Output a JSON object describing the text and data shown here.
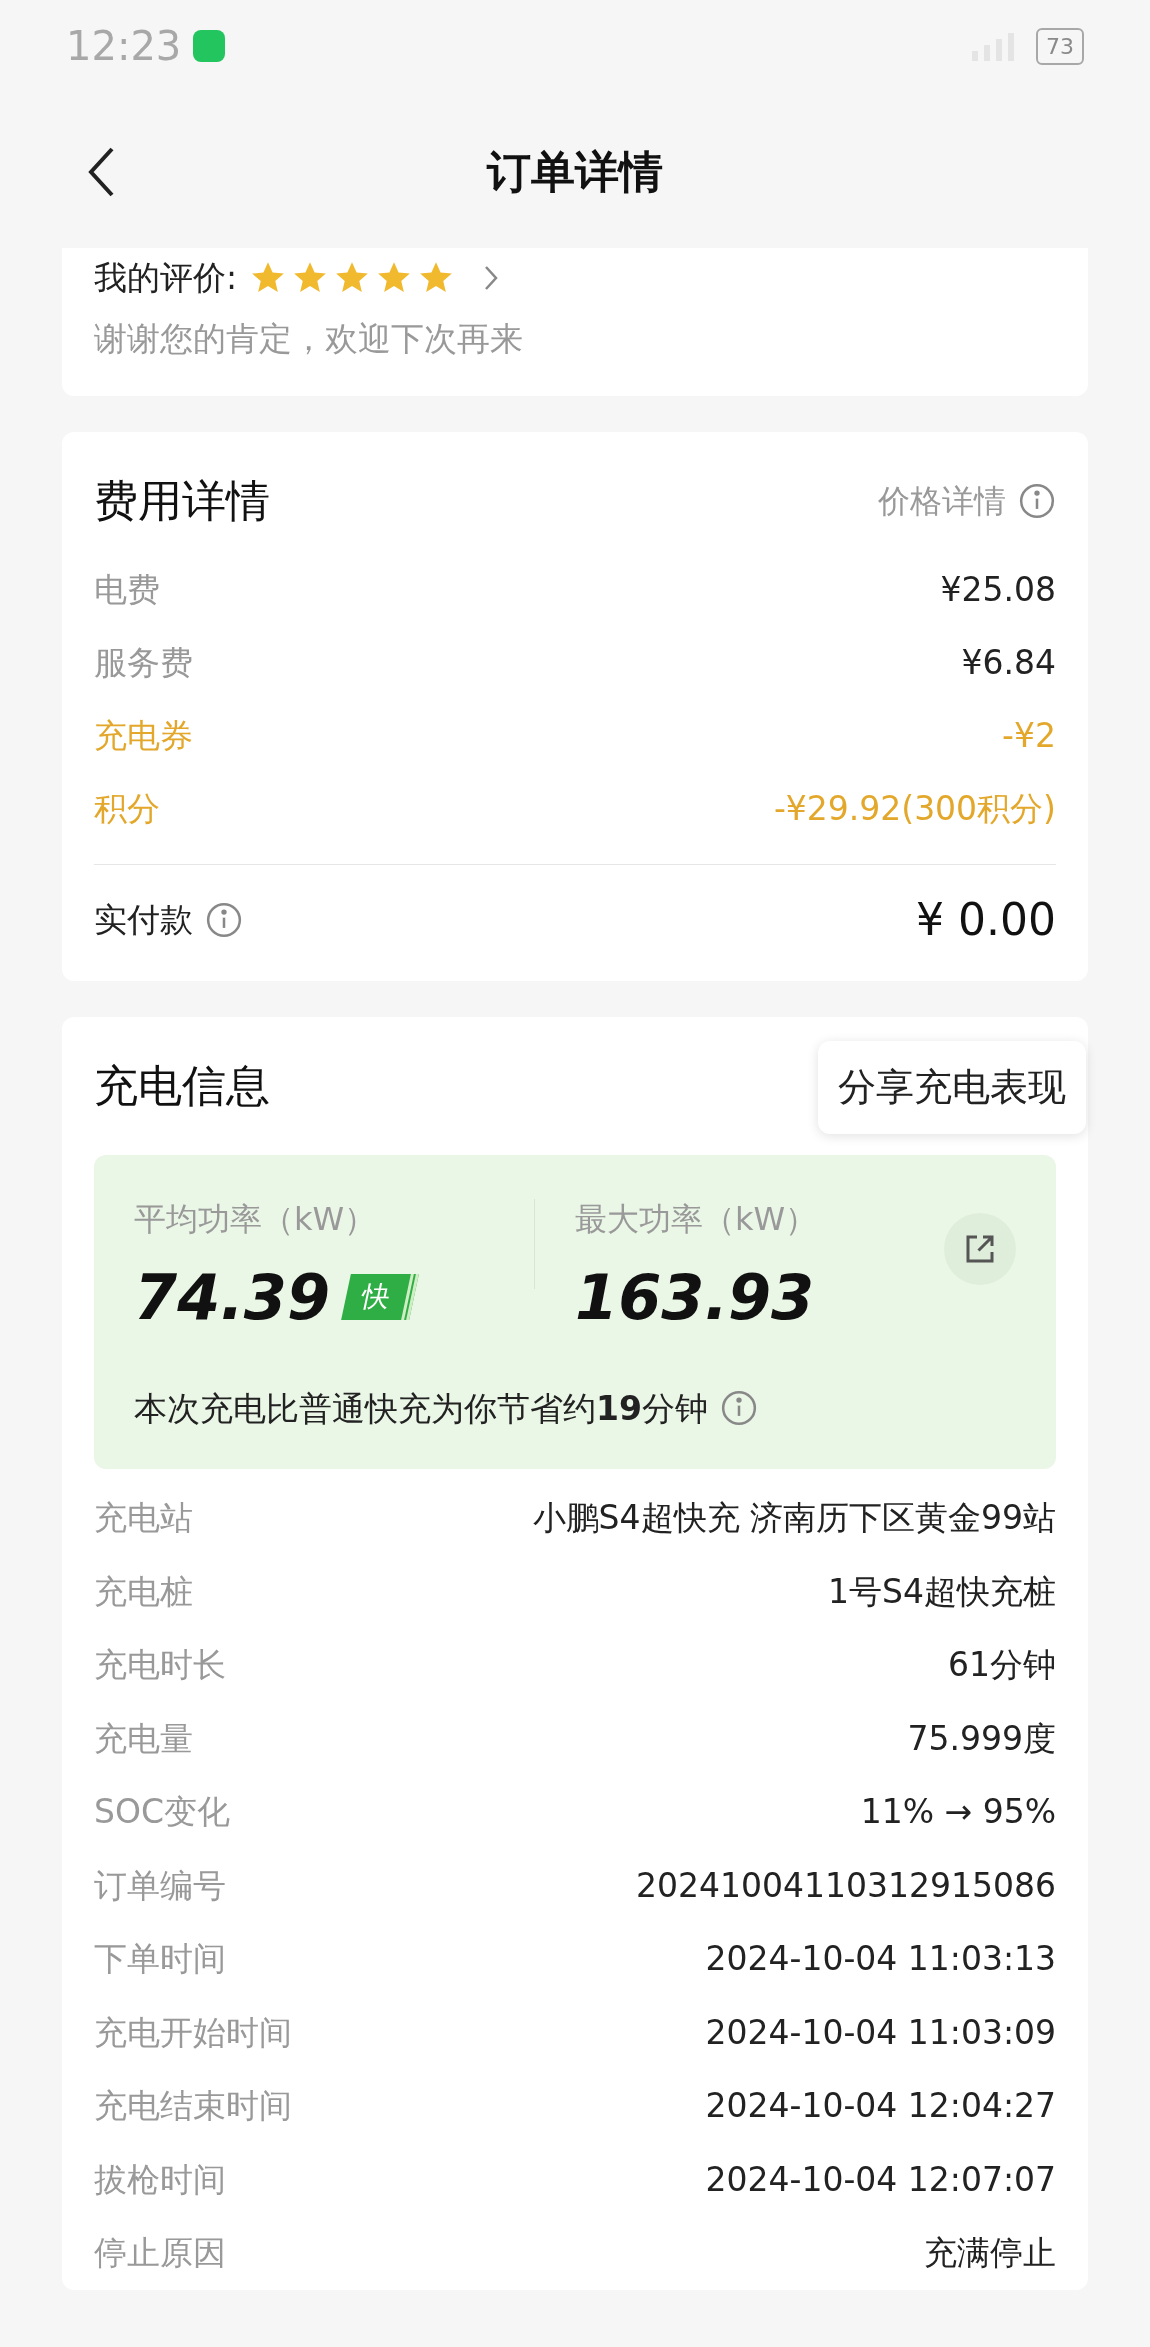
{
  "status_bar": {
    "time": "12:23",
    "battery": "73"
  },
  "header": {
    "title": "订单详情"
  },
  "rating": {
    "label": "我的评价:",
    "stars": 5,
    "comment": "谢谢您的肯定，欢迎下次再来"
  },
  "fees": {
    "title": "费用详情",
    "price_link": "价格详情",
    "rows": [
      {
        "label": "电费",
        "value": "¥25.08",
        "kind": "normal"
      },
      {
        "label": "服务费",
        "value": "¥6.84",
        "kind": "normal"
      },
      {
        "label": "充电券",
        "value": "-¥2",
        "kind": "discount"
      },
      {
        "label": "积分",
        "value": "-¥29.92(300积分)",
        "kind": "discount"
      }
    ],
    "total_label": "实付款",
    "total_value": "¥ 0.00"
  },
  "charging": {
    "title": "充电信息",
    "tooltip": "分享充电表现",
    "avg_label": "平均功率（kW）",
    "avg_value": "74.39",
    "avg_badge": "快",
    "max_label": "最大功率（kW）",
    "max_value": "163.93",
    "saving_note": "本次充电比普通快充为你节省约**19**分钟",
    "rows": [
      {
        "label": "充电站",
        "value": "小鹏S4超快充 济南历下区黄金99站"
      },
      {
        "label": "充电桩",
        "value": "1号S4超快充桩"
      },
      {
        "label": "充电时长",
        "value": "61分钟"
      },
      {
        "label": "充电量",
        "value": "75.999度"
      },
      {
        "label": "SOC变化",
        "value": "11% → 95%"
      },
      {
        "label": "订单编号",
        "value": "20241004110312915086"
      },
      {
        "label": "下单时间",
        "value": "2024-10-04 11:03:13"
      },
      {
        "label": "充电开始时间",
        "value": "2024-10-04 11:03:09"
      },
      {
        "label": "充电结束时间",
        "value": "2024-10-04 12:04:27"
      },
      {
        "label": "拔枪时间",
        "value": "2024-10-04 12:07:07"
      },
      {
        "label": "停止原因",
        "value": "充满停止"
      }
    ]
  }
}
